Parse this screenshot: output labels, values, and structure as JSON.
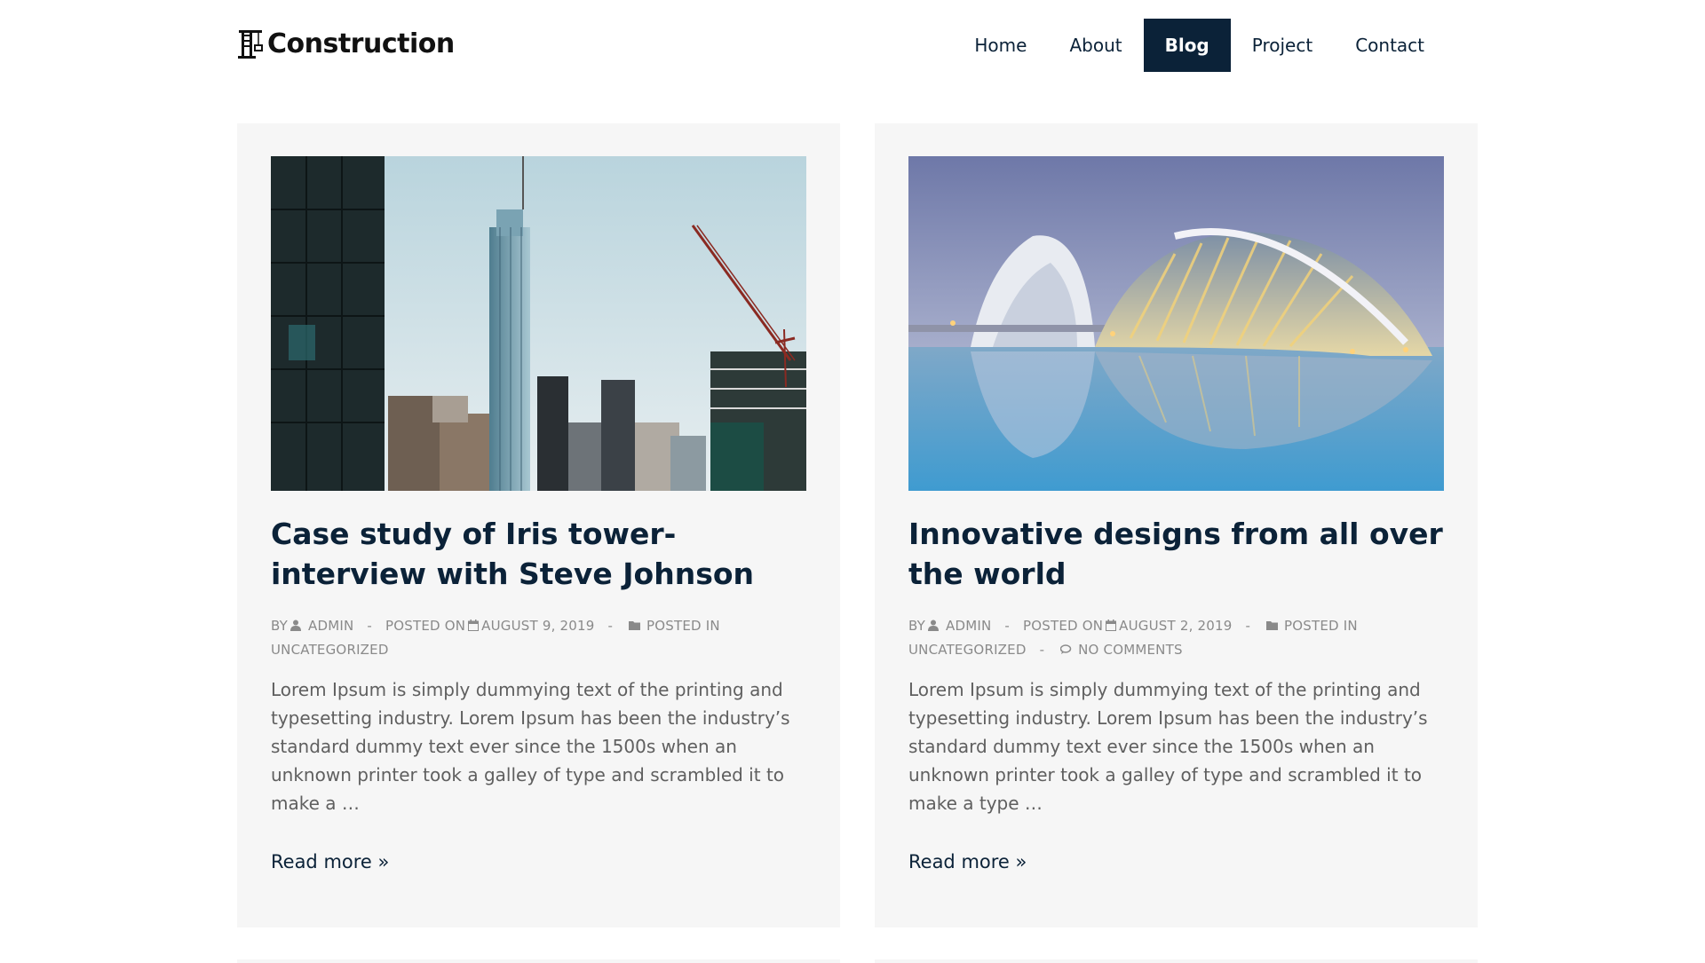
{
  "brand": {
    "name": "Construction",
    "logo_icon": "crane-icon"
  },
  "nav": {
    "items": [
      {
        "label": "Home",
        "active": false
      },
      {
        "label": "About",
        "active": false
      },
      {
        "label": "Blog",
        "active": true
      },
      {
        "label": "Project",
        "active": false
      },
      {
        "label": "Contact",
        "active": false
      }
    ],
    "active_color": "#0b2238"
  },
  "posts": [
    {
      "image": "city-skyline-with-crane",
      "title": "Case study of Iris tower- interview with Steve Johnson",
      "meta": {
        "by_label": "BY",
        "author": "ADMIN",
        "posted_on_label": "POSTED ON",
        "date": "AUGUST 9, 2019",
        "posted_in_label": "POSTED IN",
        "category": "UNCATEGORIZED",
        "comments": ""
      },
      "excerpt": "Lorem Ipsum is simply dummying text of the printing and typesetting industry. Lorem Ipsum has been the industry’s standard dummy text ever since the 1500s when an unknown printer took a galley of type and scrambled it to make a …",
      "read_more": "Read more »"
    },
    {
      "image": "futuristic-architecture-reflection",
      "title": "Innovative designs from all over the world",
      "meta": {
        "by_label": "BY",
        "author": "ADMIN",
        "posted_on_label": "POSTED ON",
        "date": "AUGUST 2, 2019",
        "posted_in_label": "POSTED IN",
        "category": "UNCATEGORIZED",
        "comments": "NO COMMENTS"
      },
      "excerpt": "Lorem Ipsum is simply dummying text of the printing and typesetting industry. Lorem Ipsum has been the industry’s standard dummy text ever since the 1500s when an unknown printer took a galley of type and scrambled it to make a type …",
      "read_more": "Read more »"
    }
  ],
  "colors": {
    "primary": "#0b2238",
    "card_bg": "#f6f6f6",
    "meta": "#8a8a8a",
    "text": "#5f5f5f"
  }
}
